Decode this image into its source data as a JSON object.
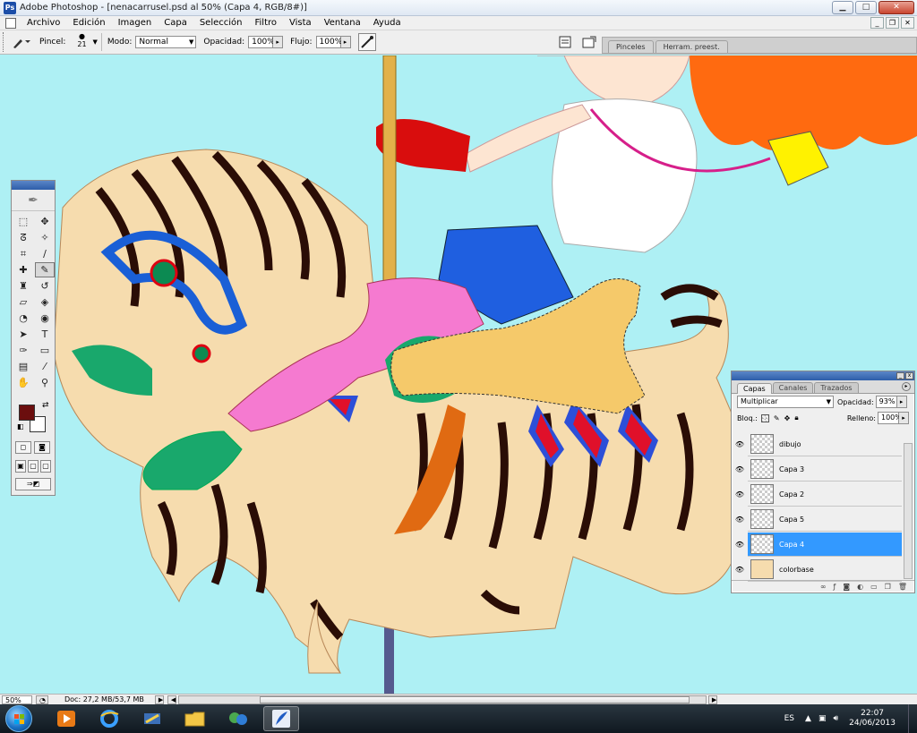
{
  "window": {
    "title": "Adobe Photoshop - [nenacarrusel.psd al 50% (Capa 4, RGB/8#)]",
    "buttons": {
      "minimize": "▁",
      "maximize": "□",
      "close": "✕"
    }
  },
  "menubar": {
    "items": [
      "Archivo",
      "Edición",
      "Imagen",
      "Capa",
      "Selección",
      "Filtro",
      "Vista",
      "Ventana",
      "Ayuda"
    ],
    "doc_buttons": {
      "minimize": "_",
      "restore": "❐",
      "close": "✕"
    }
  },
  "options": {
    "brush_label": "Pincel:",
    "brush_size": "21",
    "mode_label": "Modo:",
    "mode_value": "Normal",
    "opacity_label": "Opacidad:",
    "opacity_value": "100%",
    "flow_label": "Flujo:",
    "flow_value": "100%",
    "palette_tabs": [
      "Pinceles",
      "Herram. preest."
    ]
  },
  "tools": {
    "foreground_color": "#6b0e0e",
    "background_color": "#ffffff",
    "items": [
      "marquee-icon",
      "move-icon",
      "lasso-icon",
      "magic-wand-icon",
      "crop-icon",
      "slice-icon",
      "healing-brush-icon",
      "brush-icon",
      "clone-stamp-icon",
      "history-brush-icon",
      "eraser-icon",
      "paint-bucket-icon",
      "blur-icon",
      "dodge-icon",
      "path-selection-icon",
      "type-icon",
      "pen-icon",
      "shape-icon",
      "notes-icon",
      "eyedropper-icon",
      "hand-icon",
      "zoom-icon"
    ],
    "selected": "brush-icon"
  },
  "layers_panel": {
    "tabs": [
      "Capas",
      "Canales",
      "Trazados"
    ],
    "active_tab": "Capas",
    "blend_mode": "Multiplicar",
    "opacity_label": "Opacidad:",
    "opacity_value": "93%",
    "lock_label": "Bloq.:",
    "fill_label": "Relleno:",
    "fill_value": "100%",
    "layers": [
      {
        "name": "dibujo",
        "selected": false
      },
      {
        "name": "Capa 3",
        "selected": false
      },
      {
        "name": "Capa 2",
        "selected": false
      },
      {
        "name": "Capa 5",
        "selected": false
      },
      {
        "name": "Capa 4",
        "selected": true
      },
      {
        "name": "colorbase",
        "selected": false
      }
    ]
  },
  "statusbar": {
    "zoom": "50%",
    "doc": "Doc: 27,2 MB/53,7 MB"
  },
  "taskbar": {
    "language": "ES",
    "time": "22:07",
    "date": "24/06/2013"
  }
}
